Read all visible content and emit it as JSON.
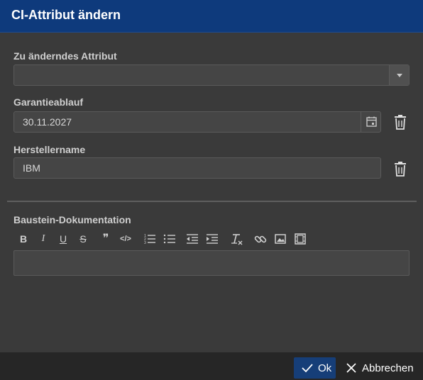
{
  "dialog": {
    "title": "CI-Attribut ändern"
  },
  "fields": {
    "attribute": {
      "label": "Zu änderndes Attribut",
      "value": ""
    },
    "warranty": {
      "label": "Garantieablauf",
      "value": "30.11.2027"
    },
    "manufacturer": {
      "label": "Herstellername",
      "value": "IBM"
    },
    "documentation": {
      "label": "Baustein-Dokumentation",
      "value": ""
    }
  },
  "toolbar": {
    "bold": "B",
    "italic": "I",
    "underline": "U",
    "strike": "S",
    "quote": "❞",
    "code": "</>"
  },
  "footer": {
    "ok_label": "Ok",
    "cancel_label": "Abbrechen"
  },
  "colors": {
    "header": "#0e3a7c",
    "background": "#3a3a3a",
    "ok_button": "#163e78",
    "footer": "#262626"
  },
  "icons": [
    "chevron-down-icon",
    "calendar-icon",
    "trash-icon",
    "check-icon",
    "close-icon",
    "link-icon",
    "image-icon",
    "video-icon"
  ]
}
